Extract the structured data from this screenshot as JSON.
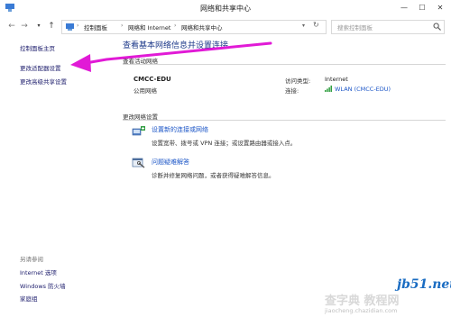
{
  "window": {
    "title": "网络和共享中心",
    "controls": {
      "minimize": "—",
      "maximize": "☐",
      "close": "✕"
    }
  },
  "address": {
    "back": "←",
    "forward": "→",
    "up": "↑",
    "crumbs": [
      "控制面板",
      "网络和 Internet",
      "网络和共享中心"
    ],
    "refresh": "↻",
    "search_placeholder": "搜索控制面板"
  },
  "sidebar": {
    "links": [
      "控制面板主页",
      "更改适配器设置",
      "更改高级共享设置"
    ],
    "see_also_title": "另请参阅",
    "see_also": [
      "Internet 选项",
      "Windows 防火墙",
      "家庭组"
    ]
  },
  "main": {
    "heading": "查看基本网络信息并设置连接",
    "active_section": "查看活动网络",
    "network": {
      "name": "CMCC-EDU",
      "type": "公用网络",
      "access_label": "访问类型:",
      "access_value": "Internet",
      "conn_label": "连接:",
      "conn_value": "WLAN (CMCC-EDU)"
    },
    "change_section": "更改网络设置",
    "tasks": [
      {
        "link": "设置新的连接或网络",
        "desc": "设置宽带、拨号或 VPN 连接；或设置路由器或接入点。"
      },
      {
        "link": "问题疑难解答",
        "desc": "诊断并修复网络问题，或者获得疑难解答信息。"
      }
    ]
  },
  "watermark": {
    "site": "jb51.net",
    "label": "查字典 教程网",
    "url": "jiaocheng.chazidian.com"
  },
  "colors": {
    "link": "#1c56c7",
    "heading": "#1e3a8a",
    "annotation_arrow": "#e11ad6"
  }
}
